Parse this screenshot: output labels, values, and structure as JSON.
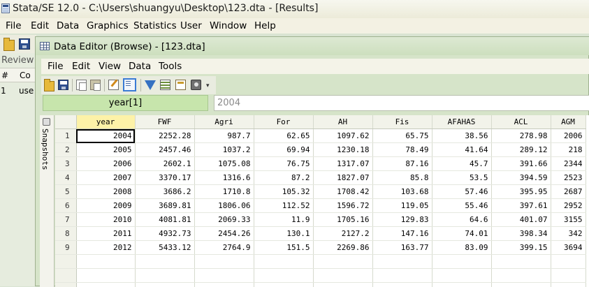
{
  "app": {
    "title": "Stata/SE 12.0 - C:\\Users\\shuangyu\\Desktop\\123.dta - [Results]",
    "menu": [
      "File",
      "Edit",
      "Data",
      "Graphics",
      "Statistics",
      "User",
      "Window",
      "Help"
    ]
  },
  "review": {
    "title": "Review",
    "col_num": "#",
    "col_cmd": "Co",
    "row_num": "1",
    "row_cmd": "use"
  },
  "editor": {
    "title": "Data Editor (Browse) - [123.dta]",
    "menu": [
      "File",
      "Edit",
      "View",
      "Data",
      "Tools"
    ],
    "toolbar_icons": [
      "open-icon",
      "save-icon",
      "copy-icon",
      "paste-icon",
      "data-editor-edit-icon",
      "data-editor-browse-icon",
      "filter-icon",
      "variables-icon",
      "properties-icon",
      "snapshots-icon"
    ],
    "cell_name": "year[1]",
    "cell_value": "2004",
    "snapshots_label": "Snapshots"
  },
  "grid": {
    "columns": [
      "year",
      "FWF",
      "Agri",
      "For",
      "AH",
      "Fis",
      "AFAHAS",
      "ACL",
      "AGM"
    ],
    "rows": [
      [
        "2004",
        "2252.28",
        "987.7",
        "62.65",
        "1097.62",
        "65.75",
        "38.56",
        "278.98",
        "2006"
      ],
      [
        "2005",
        "2457.46",
        "1037.2",
        "69.94",
        "1230.18",
        "78.49",
        "41.64",
        "289.12",
        "218"
      ],
      [
        "2006",
        "2602.1",
        "1075.08",
        "76.75",
        "1317.07",
        "87.16",
        "45.7",
        "391.66",
        "2344"
      ],
      [
        "2007",
        "3370.17",
        "1316.6",
        "87.2",
        "1827.07",
        "85.8",
        "53.5",
        "394.59",
        "2523"
      ],
      [
        "2008",
        "3686.2",
        "1710.8",
        "105.32",
        "1708.42",
        "103.68",
        "57.46",
        "395.95",
        "2687"
      ],
      [
        "2009",
        "3689.81",
        "1806.06",
        "112.52",
        "1596.72",
        "119.05",
        "55.46",
        "397.61",
        "2952"
      ],
      [
        "2010",
        "4081.81",
        "2069.33",
        "11.9",
        "1705.16",
        "129.83",
        "64.6",
        "401.07",
        "3155"
      ],
      [
        "2011",
        "4932.73",
        "2454.26",
        "130.1",
        "2127.2",
        "147.16",
        "74.01",
        "398.34",
        "342"
      ],
      [
        "2012",
        "5433.12",
        "2764.9",
        "151.5",
        "2269.86",
        "163.77",
        "83.09",
        "399.15",
        "3694"
      ]
    ]
  }
}
